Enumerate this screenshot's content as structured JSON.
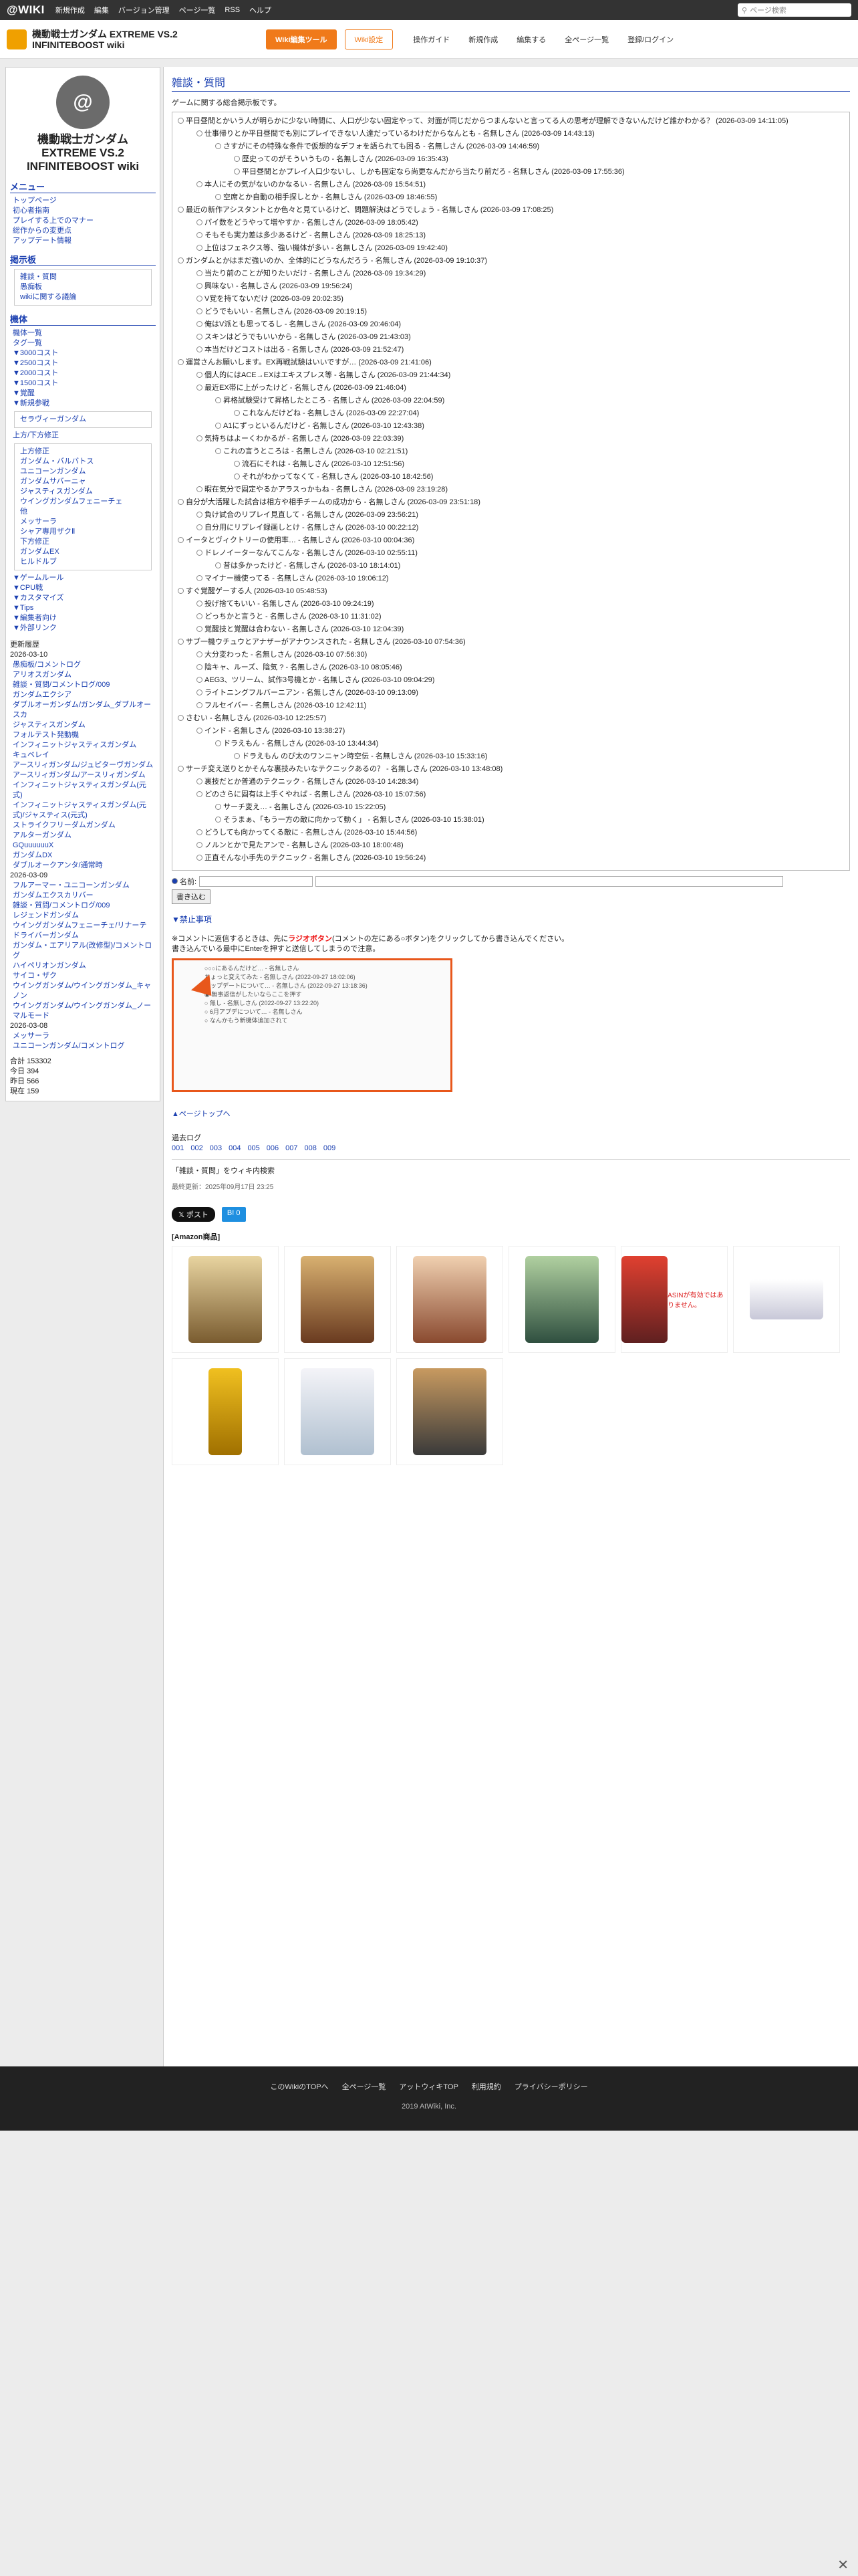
{
  "topbar": {
    "logo": "@WIKI",
    "menu": [
      "新規作成",
      "編集",
      "バージョン管理",
      "ページ一覧",
      "RSS",
      "ヘルプ"
    ],
    "search_placeholder": "ページ検索"
  },
  "header": {
    "title": "機動戦士ガンダム EXTREME VS.2 INFINITEBOOST wiki",
    "btn_orange": "Wiki編集ツール",
    "btn_outline": "Wiki設定",
    "nav": [
      "操作ガイド",
      "新規作成",
      "編集する",
      "全ページ一覧",
      "登録/ログイン"
    ]
  },
  "sidebar": {
    "logo_text": "@",
    "site_name": "機動戦士ガンダム EXTREME VS.2 INFINITEBOOST wiki",
    "menu_title": "メニュー",
    "menu_items": [
      "トップページ",
      "初心者指南",
      "プレイする上でのマナー",
      "総作からの変更点",
      "アップデート情報"
    ],
    "notice_title": "掲示板",
    "notice_items": [
      "雑談・質問",
      "愚痴板",
      "wikiに関する議論"
    ],
    "unit_title": "機体",
    "unit_items": [
      "機体一覧",
      "タグ一覧",
      "▼3000コスト",
      "▼2500コスト",
      "▼2000コスト",
      "▼1500コスト",
      "▼覚醒",
      "▼新規参戦"
    ],
    "new_unit_box": [
      "セラヴィーガンダム"
    ],
    "upward_title": "上方/下方修正",
    "upward_box": [
      "上方修正",
      "ガンダム・バルバトス",
      "ユニコーンガンダム",
      "ガンダムサバーニャ",
      "ジャスティスガンダム",
      "ウイングガンダムフェニーチェ",
      "他",
      "メッサーラ",
      "シャア専用ザクⅡ",
      "下方修正",
      "ガンダムEX",
      "ヒルドルブ"
    ],
    "extra_links": [
      "▼ゲームルール",
      "▼CPU戦",
      "▼カスタマイズ",
      "▼Tips",
      "▼編集者向け",
      "▼外部リンク"
    ],
    "updates_title": "更新履歴",
    "updates_date1": "2026-03-10",
    "updates_list1": [
      "愚痴板/コメントログ",
      "アリオスガンダム",
      "雑談・質問/コメントログ/009",
      "ガンダムエクシア",
      "ダブルオーガンダム/ガンダム_ダブルオースカ",
      "ジャスティスガンダム",
      "フォルテスト発動機",
      "インフィニットジャスティスガンダム",
      "キュベレイ",
      "アースリィガンダム/ジュピターヴガンダム",
      "アースリィガンダム/アースリィガンダム",
      "インフィニットジャスティスガンダム(元式)",
      "インフィニットジャスティスガンダム(元式)/ジャスティス(元式)",
      "ストライクフリーダムガンダム",
      "アルターガンダム",
      "GQuuuuuuX",
      "ガンダムDX",
      "ダブルオークアンタ/通常時"
    ],
    "updates_date2": "2026-03-09",
    "updates_list2": [
      "フルアーマー・ユニコーンガンダム",
      "ガンダムエクスカリバー",
      "雑談・質問/コメントログ/009",
      "レジェンドガンダム",
      "ウイングガンダムフェニーチェ/リナーテ",
      "ドライバーガンダム",
      "ガンダム・エアリアル(改修型)/コメントログ",
      "ハイペリオンガンダム",
      "サイコ・ザク",
      "ウイングガンダム/ウイングガンダム_キャノン",
      "ウイングガンダム/ウイングガンダム_ノーマルモード"
    ],
    "updates_date3": "2026-03-08",
    "updates_list3": [
      "メッサーラ",
      "ユニコーンガンダム/コメントログ"
    ],
    "counts": {
      "total_label": "合計",
      "total": "153302",
      "today_label": "今日",
      "today": "394",
      "yesterday_label": "昨日",
      "yesterday": "566",
      "now_label": "現在",
      "now": "159"
    }
  },
  "main": {
    "page_title": "雑談・質問",
    "intro": "ゲームに関する総合掲示板です。",
    "comments": [
      {
        "level": 0,
        "text": "平日昼間とかいう人が明らかに少ない時間に、人口が少ない固定やって、対面が同じだからつまんないと言ってる人の思考が理解できないんだけど誰かわかる？ (2026-03-09 14:11:05)"
      },
      {
        "level": 1,
        "text": "仕事帰りとか平日昼間でも別にプレイできない人達だっているわけだからなんとも - 名無しさん (2026-03-09 14:43:13)"
      },
      {
        "level": 2,
        "text": "さすがにその特殊な条件で仮想的なデフォを語られても困る - 名無しさん (2026-03-09 14:46:59)"
      },
      {
        "level": 3,
        "text": "歴史ってのがそういうもの - 名無しさん (2026-03-09 16:35:43)"
      },
      {
        "level": 3,
        "text": "平日昼間とかプレイ人口少ないし、しかも固定なら尚更なんだから当たり前だろ - 名無しさん (2026-03-09 17:55:36)"
      },
      {
        "level": 1,
        "text": "本人にその気がないのかなるい - 名無しさん (2026-03-09 15:54:51)"
      },
      {
        "level": 2,
        "text": "空席とか自動の相手探しとか - 名無しさん (2026-03-09 18:46:55)"
      },
      {
        "level": 0,
        "text": "最近の新作アシスタントとか色々と見ているけど、問題解決はどうでしょう - 名無しさん (2026-03-09 17:08:25)"
      },
      {
        "level": 1,
        "text": "パイ数をどうやって増やすか - 名無しさん (2026-03-09 18:05:42)"
      },
      {
        "level": 1,
        "text": "そもそも実力差は多少あるけど - 名無しさん (2026-03-09 18:25:13)"
      },
      {
        "level": 1,
        "text": "上位はフェネクス等、強い機体が多い - 名無しさん (2026-03-09 19:42:40)"
      },
      {
        "level": 0,
        "text": "ガンダムとかはまだ強いのか、全体的にどうなんだろう - 名無しさん (2026-03-09 19:10:37)"
      },
      {
        "level": 1,
        "text": "当たり前のことが知りたいだけ - 名無しさん (2026-03-09 19:34:29)"
      },
      {
        "level": 1,
        "text": "興味ない - 名無しさん (2026-03-09 19:56:24)"
      },
      {
        "level": 1,
        "text": "V覚を持てないだけ (2026-03-09 20:02:35)"
      },
      {
        "level": 1,
        "text": "どうでもいい - 名無しさん (2026-03-09 20:19:15)"
      },
      {
        "level": 1,
        "text": "俺はV派とも思ってるし - 名無しさん (2026-03-09 20:46:04)"
      },
      {
        "level": 1,
        "text": "スキンはどうでもいいから - 名無しさん (2026-03-09 21:43:03)"
      },
      {
        "level": 1,
        "text": "本当だけどコストは出る - 名無しさん (2026-03-09 21:52:47)"
      },
      {
        "level": 0,
        "text": "運営さんお願いします。EX再戦試験はいいですが… (2026-03-09 21:41:06)"
      },
      {
        "level": 1,
        "text": "個人的にはACE→EXはエキスプレス等 - 名無しさん (2026-03-09 21:44:34)"
      },
      {
        "level": 1,
        "text": "最近EX帯に上がったけど - 名無しさん (2026-03-09 21:46:04)"
      },
      {
        "level": 2,
        "text": "昇格試験受けて昇格したところ - 名無しさん (2026-03-09 22:04:59)"
      },
      {
        "level": 3,
        "text": "これなんだけどね - 名無しさん (2026-03-09 22:27:04)"
      },
      {
        "level": 2,
        "text": "A1にずっといるんだけど - 名無しさん (2026-03-10 12:43:38)"
      },
      {
        "level": 1,
        "text": "気持ちはよーくわかるが - 名無しさん (2026-03-09 22:03:39)"
      },
      {
        "level": 2,
        "text": "これの言うところは - 名無しさん (2026-03-10 02:21:51)"
      },
      {
        "level": 3,
        "text": "流石にそれは - 名無しさん (2026-03-10 12:51:56)"
      },
      {
        "level": 3,
        "text": "それがわかってなくて - 名無しさん (2026-03-10 18:42:56)"
      },
      {
        "level": 1,
        "text": "暇在気分で固定やるかアラスっかもね - 名無しさん (2026-03-09 23:19:28)"
      },
      {
        "level": 0,
        "text": "自分が大活躍した試合は相方や相手チームの成功から - 名無しさん (2026-03-09 23:51:18)"
      },
      {
        "level": 1,
        "text": "負け試合のリプレイ見直して - 名無しさん (2026-03-09 23:56:21)"
      },
      {
        "level": 1,
        "text": "自分用にリプレイ録画しとけ - 名無しさん (2026-03-10 00:22:12)"
      },
      {
        "level": 0,
        "text": "イータとヴィクトリーの使用率… - 名無しさん (2026-03-10 00:04:36)"
      },
      {
        "level": 1,
        "text": "ドレノイーターなんてこんな - 名無しさん (2026-03-10 02:55:11)"
      },
      {
        "level": 2,
        "text": "昔は多かったけど - 名無しさん (2026-03-10 18:14:01)"
      },
      {
        "level": 1,
        "text": "マイナー機使ってる - 名無しさん (2026-03-10 19:06:12)"
      },
      {
        "level": 0,
        "text": "すぐ覚醒ゲーする人 (2026-03-10 05:48:53)"
      },
      {
        "level": 1,
        "text": "投げ捨てもいい - 名無しさん (2026-03-10 09:24:19)"
      },
      {
        "level": 1,
        "text": "どっちかと言うと - 名無しさん (2026-03-10 11:31:02)"
      },
      {
        "level": 1,
        "text": "覚醒技と覚醒は合わない - 名無しさん (2026-03-10 12:04:39)"
      },
      {
        "level": 0,
        "text": "サブ一機ウチュウとアナザーがアナウンスされた - 名無しさん (2026-03-10 07:54:36)"
      },
      {
        "level": 1,
        "text": "大分変わった - 名無しさん (2026-03-10 07:56:30)"
      },
      {
        "level": 1,
        "text": "陰キャ、ルーズ、陰気 ? - 名無しさん (2026-03-10 08:05:46)"
      },
      {
        "level": 1,
        "text": "AEG3、ツリーム、試作3号機とか - 名無しさん (2026-03-10 09:04:29)"
      },
      {
        "level": 1,
        "text": "ライトニングフルバーニアン - 名無しさん (2026-03-10 09:13:09)"
      },
      {
        "level": 1,
        "text": "フルセイバー - 名無しさん (2026-03-10 12:42:11)"
      },
      {
        "level": 0,
        "text": "さむい - 名無しさん (2026-03-10 12:25:57)"
      },
      {
        "level": 1,
        "text": "インド - 名無しさん (2026-03-10 13:38:27)"
      },
      {
        "level": 2,
        "text": "ドラえもん - 名無しさん (2026-03-10 13:44:34)"
      },
      {
        "level": 3,
        "text": "ドラえもん のび太のワンニャン時空伝 - 名無しさん (2026-03-10 15:33:16)"
      },
      {
        "level": 0,
        "text": "サーチ変え送りとかそんな裏技みたいなテクニックあるの？ - 名無しさん (2026-03-10 13:48:08)"
      },
      {
        "level": 1,
        "text": "裏技だとか普通のテクニック - 名無しさん (2026-03-10 14:28:34)"
      },
      {
        "level": 1,
        "text": "どのさらに固有は上手くやれば - 名無しさん (2026-03-10 15:07:56)"
      },
      {
        "level": 2,
        "text": "サーチ変え… - 名無しさん (2026-03-10 15:22:05)"
      },
      {
        "level": 2,
        "text": "そうまぁ、「もう一方の敵に向かって動く」 - 名無しさん (2026-03-10 15:38:01)"
      },
      {
        "level": 1,
        "text": "どうしても向かってくる敵に - 名無しさん (2026-03-10 15:44:56)"
      },
      {
        "level": 1,
        "text": "ノルンとかで見たアンで - 名無しさん (2026-03-10 18:00:48)"
      },
      {
        "level": 1,
        "text": "正直そんな小手先のテクニック - 名無しさん (2026-03-10 19:56:24)"
      }
    ],
    "name_label": "名前:",
    "submit_label": "書き込む",
    "note_title": "▼禁止事項",
    "note_line1_pre": "※コメントに返信するときは、先に",
    "note_line1_red": "ラジオボタン",
    "note_line1_post": "(コメントの左にある○ボタン)をクリックしてから書き込んでください。",
    "note_line2": "書き込んでいる最中にEnterを押すと送信してしまうので注意。",
    "example_lines": [
      "○○○にあるんだけど… - 名無しさん",
      "ちょっと変えてみた - 名無しさん (2022-09-27 18:02:06)",
      "アップデートについて… - 名無しさん (2022-09-27 13:18:36)",
      "◉ 無事返信がしたいならここを押す",
      "○ 無し - 名無しさん (2022-09-27 13:22:20)",
      "○ 6月アプデについて… - 名無しさん",
      "○ なんかもう新機体追加されて"
    ],
    "page_links_title": "▲ページトップへ",
    "log_title": "過去ログ",
    "log_items": [
      "001",
      "002",
      "003",
      "004",
      "005",
      "006",
      "007",
      "008",
      "009"
    ],
    "meta_line": "「雑談・質問」をウィキ内検索",
    "last_update": "最終更新：2025年09月17日 23:25",
    "share_post": "ポスト",
    "share_hatena": "B! 0",
    "amazon_title": "[Amazon商品]",
    "asin_note": "ASINが有効ではありません。"
  },
  "footer": {
    "links": [
      "このWikiのTOPへ",
      "全ページ一覧",
      "アットウィキTOP",
      "利用規約",
      "プライバシーポリシー"
    ],
    "copyright": "2019 AtWiki, Inc."
  },
  "colors": {
    "accent": "#1a3fb0",
    "orange": "#f07a1a",
    "topbar": "#333333"
  }
}
